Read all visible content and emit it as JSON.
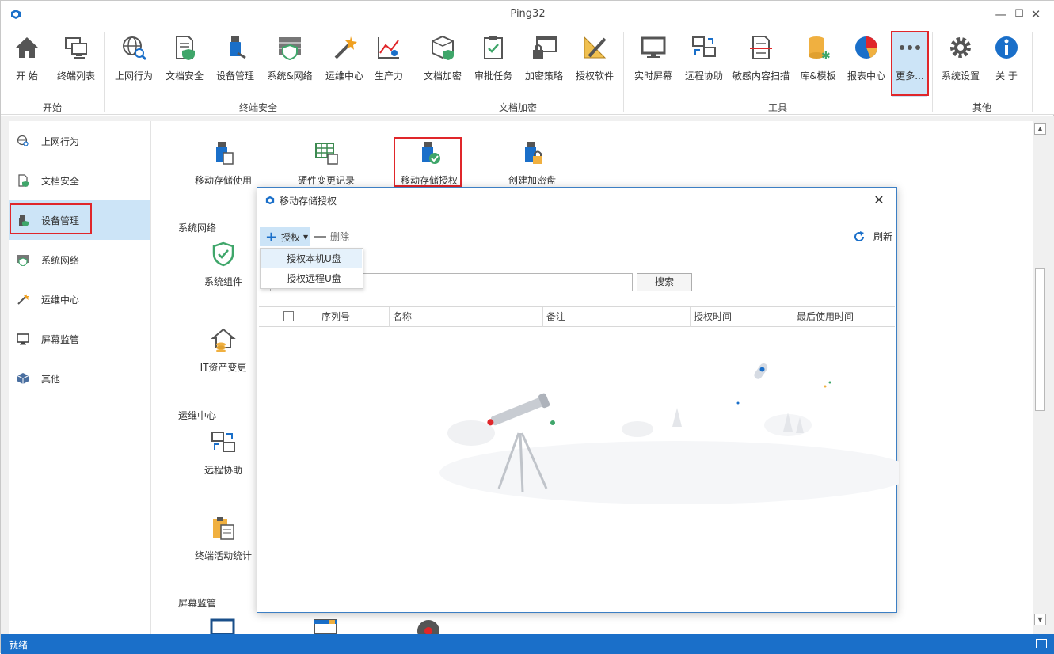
{
  "window": {
    "title": "Ping32",
    "minimize": "—",
    "maximize": "☐",
    "close": "✕"
  },
  "ribbon": {
    "items": [
      {
        "label": "开 始"
      },
      {
        "label": "终端列表"
      },
      {
        "label": "上网行为"
      },
      {
        "label": "文档安全"
      },
      {
        "label": "设备管理"
      },
      {
        "label": "系统&网络"
      },
      {
        "label": "运维中心"
      },
      {
        "label": "生产力"
      },
      {
        "label": "文档加密"
      },
      {
        "label": "审批任务"
      },
      {
        "label": "加密策略"
      },
      {
        "label": "授权软件"
      },
      {
        "label": "实时屏幕"
      },
      {
        "label": "远程协助"
      },
      {
        "label": "敏感内容扫描"
      },
      {
        "label": "库&模板"
      },
      {
        "label": "报表中心"
      },
      {
        "label": "更多..."
      },
      {
        "label": "系统设置"
      },
      {
        "label": "关 于"
      }
    ],
    "groups": [
      "开始",
      "终端安全",
      "文档加密",
      "工具",
      "其他"
    ]
  },
  "sidebar": {
    "items": [
      {
        "label": "上网行为"
      },
      {
        "label": "文档安全"
      },
      {
        "label": "设备管理"
      },
      {
        "label": "系统网络"
      },
      {
        "label": "运维中心"
      },
      {
        "label": "屏幕监管"
      },
      {
        "label": "其他"
      }
    ]
  },
  "content": {
    "top_items": [
      "移动存储使用",
      "硬件变更记录",
      "移动存储授权",
      "创建加密盘"
    ],
    "sections": {
      "network": "系统网络",
      "network_item": "系统组件",
      "asset_item": "IT资产变更",
      "ops": "运维中心",
      "ops_item": "远程协助",
      "stats_item": "终端活动统计",
      "screen": "屏幕监管"
    }
  },
  "dialog": {
    "title": "移动存储授权",
    "close": "✕",
    "grant": "授权",
    "delete": "删除",
    "refresh": "刷新",
    "menu": [
      "授权本机U盘",
      "授权远程U盘"
    ],
    "search_value": ".",
    "search_button": "搜索",
    "columns": [
      "序列号",
      "名称",
      "备注",
      "授权时间",
      "最后使用时间"
    ]
  },
  "status": {
    "text": "就绪"
  },
  "colors": {
    "accent": "#1a6fc9",
    "highlight": "#cce4f7",
    "red": "#e0262a"
  }
}
